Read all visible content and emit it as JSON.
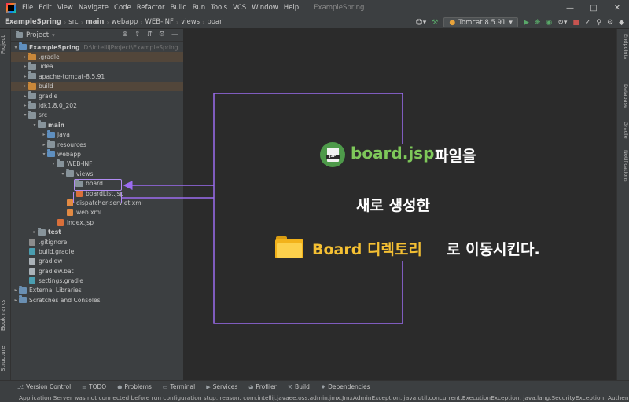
{
  "menu": {
    "items": [
      "File",
      "Edit",
      "View",
      "Navigate",
      "Code",
      "Refactor",
      "Build",
      "Run",
      "Tools",
      "VCS",
      "Window",
      "Help"
    ],
    "window_title": "ExampleSpring"
  },
  "breadcrumb": [
    "ExampleSpring",
    "src",
    "main",
    "webapp",
    "WEB-INF",
    "views",
    "boar"
  ],
  "toolbar": {
    "run_config": "Tomcat 8.5.91"
  },
  "left_strip": {
    "tabs": [
      "Project",
      "Bookmarks",
      "Structure"
    ]
  },
  "right_strip": {
    "tabs": [
      "Endpoints",
      "Database",
      "Gradle",
      "Notifications"
    ]
  },
  "project_panel": {
    "title": "Project",
    "tree": [
      {
        "label": "ExampleSpring",
        "hint": "D:\\IntelliJProject\\ExampleSpring",
        "bold": true
      },
      {
        "label": ".gradle"
      },
      {
        "label": ".idea"
      },
      {
        "label": "apache-tomcat-8.5.91"
      },
      {
        "label": "build"
      },
      {
        "label": "gradle"
      },
      {
        "label": "jdk1.8.0_202"
      },
      {
        "label": "src"
      },
      {
        "label": "main",
        "bold": true
      },
      {
        "label": "java"
      },
      {
        "label": "resources"
      },
      {
        "label": "webapp"
      },
      {
        "label": "WEB-INF"
      },
      {
        "label": "views"
      },
      {
        "label": "board"
      },
      {
        "label": "boardList.jsp"
      },
      {
        "label": "dispatcher-servlet.xml"
      },
      {
        "label": "web.xml"
      },
      {
        "label": "index.jsp"
      },
      {
        "label": "test",
        "bold": true
      },
      {
        "label": ".gitignore"
      },
      {
        "label": "build.gradle"
      },
      {
        "label": "gradlew"
      },
      {
        "label": "gradlew.bat"
      },
      {
        "label": "settings.gradle"
      },
      {
        "label": "External Libraries"
      },
      {
        "label": "Scratches and Consoles"
      }
    ]
  },
  "bottom_tabs": [
    "Version Control",
    "TODO",
    "Problems",
    "Terminal",
    "Services",
    "Profiler",
    "Build",
    "Dependencies"
  ],
  "status_text": "Application Server was not connected before run configuration stop, reason: com.intellij.javaee.oss.admin.jmx.JmxAdminException: java.util.concurrent.ExecutionException: java.lang.SecurityException: Authenti... (11 minutes",
  "annotation": {
    "line1_file": "board.jsp",
    "line1_rest": "파일을",
    "line2": "새로 생성한",
    "line3_dir": "Board 디렉토리",
    "line3_rest": "로 이동시킨다.",
    "jsp_badge": "JSP",
    "colors": {
      "file": "#7ec85a",
      "dir": "#f5c033",
      "arrow": "#9b6cf0",
      "box": "#9b6cf0"
    }
  }
}
